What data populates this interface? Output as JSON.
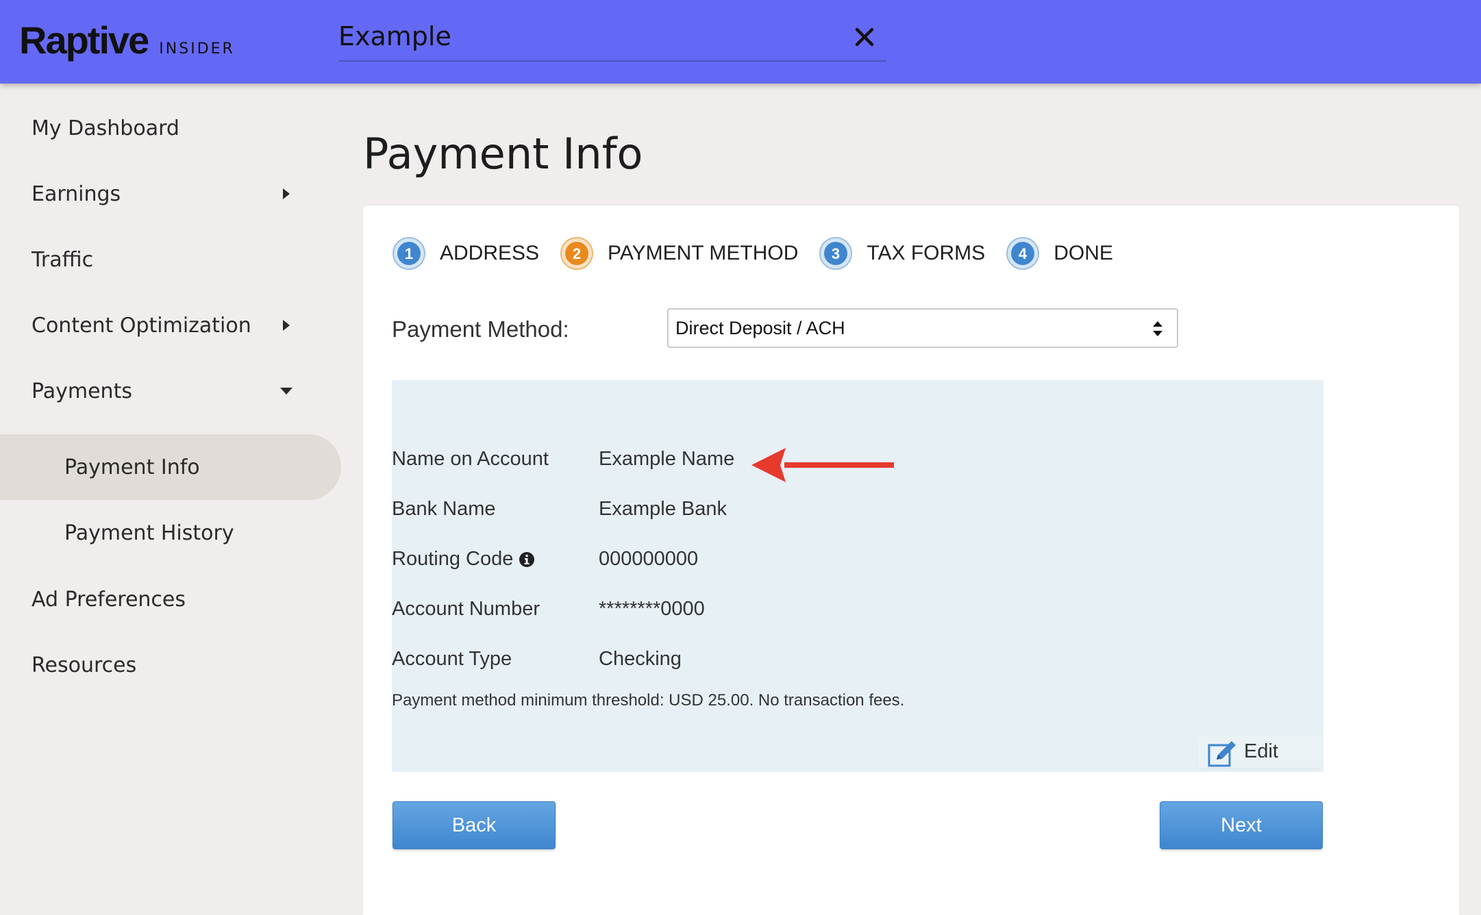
{
  "header": {
    "logo": "Raptive",
    "logo_sub": "INSIDER",
    "search_value": "Example",
    "bar_color": "#6469f5"
  },
  "sidebar": {
    "items": [
      {
        "label": "My Dashboard"
      },
      {
        "label": "Earnings",
        "icon": "chevron-right-icon"
      },
      {
        "label": "Traffic"
      },
      {
        "label": "Content Optimization",
        "icon": "chevron-right-icon"
      },
      {
        "label": "Payments",
        "icon": "chevron-down-icon",
        "expanded": true
      },
      {
        "label": "Payment Info",
        "active": true
      },
      {
        "label": "Payment History"
      },
      {
        "label": "Ad Preferences"
      },
      {
        "label": "Resources"
      }
    ]
  },
  "main": {
    "title": "Payment Info",
    "steps": [
      {
        "number": "1",
        "label": "ADDRESS",
        "color": "#3f86cf"
      },
      {
        "number": "2",
        "label": "PAYMENT METHOD",
        "color": "#e88a1e"
      },
      {
        "number": "3",
        "label": "TAX FORMS",
        "color": "#3f86cf"
      },
      {
        "number": "4",
        "label": "DONE",
        "color": "#3f86cf"
      }
    ],
    "payment_method_label": "Payment Method:",
    "payment_method_value": "Direct Deposit / ACH",
    "details": [
      {
        "label": "Name on Account",
        "value": "Example Name"
      },
      {
        "label": "Bank Name",
        "value": "Example Bank"
      },
      {
        "label": "Routing Code",
        "value": "000000000",
        "info_icon": true
      },
      {
        "label": "Account Number",
        "value": "********0000"
      },
      {
        "label": "Account Type",
        "value": "Checking"
      }
    ],
    "threshold_text": "Payment method minimum threshold: USD 25.00. No transaction fees.",
    "edit_label": "Edit",
    "back_label": "Back",
    "next_label": "Next",
    "annotation_arrow_color": "#e53a2c"
  }
}
